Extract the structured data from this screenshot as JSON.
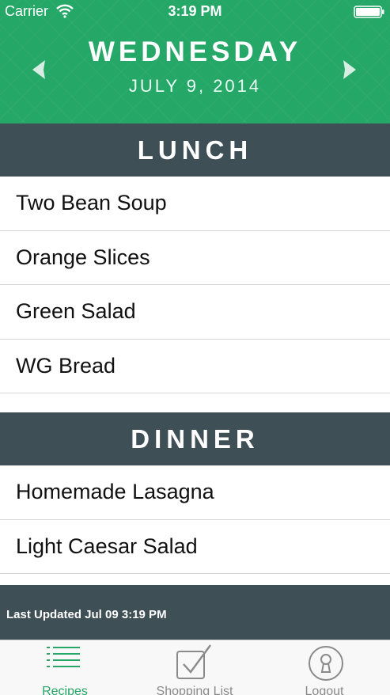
{
  "status_bar": {
    "carrier": "Carrier",
    "time": "3:19 PM",
    "wifi_icon": "wifi-icon",
    "battery_icon": "battery-icon"
  },
  "header": {
    "day": "WEDNESDAY",
    "date": "JULY 9, 2014",
    "prev_icon": "chevron-left-icon",
    "next_icon": "chevron-right-icon",
    "background_color": "#25a767"
  },
  "sections": {
    "lunch": {
      "title": "LUNCH",
      "items": [
        "Two Bean Soup",
        "Orange Slices",
        "Green Salad",
        "WG Bread"
      ]
    },
    "dinner": {
      "title": "DINNER",
      "items": [
        "Homemade Lasagna",
        "Light Caesar Salad"
      ]
    }
  },
  "footer": {
    "last_updated": "Last Updated Jul 09 3:19 PM"
  },
  "tab_bar": {
    "tabs": [
      {
        "label": "Recipes",
        "icon": "list-icon",
        "active": true
      },
      {
        "label": "Shopping List",
        "icon": "checkbox-icon",
        "active": false
      },
      {
        "label": "Logout",
        "icon": "keyhole-icon",
        "active": false
      }
    ],
    "active_color": "#25a767",
    "inactive_color": "#8a8a8a"
  },
  "colors": {
    "section_header": "#3f4f56"
  }
}
